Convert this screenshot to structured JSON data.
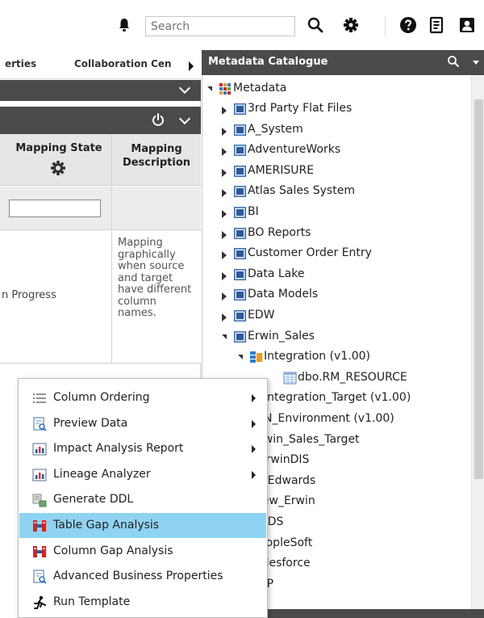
{
  "toolbar": {
    "search_placeholder": "Search"
  },
  "left_panel": {
    "tabs": [
      {
        "label": "erties"
      },
      {
        "label": "Collaboration Cen"
      }
    ],
    "grid": {
      "columns": [
        {
          "label": "Mapping State"
        },
        {
          "label": "Mapping Description"
        }
      ],
      "rows": [
        {
          "state": "n Progress",
          "description": "Mapping graphically when source and target have different column names."
        }
      ]
    }
  },
  "context_menu": {
    "items": [
      {
        "label": "Column Ordering",
        "icon": "list-icon",
        "submenu": true
      },
      {
        "label": "Preview Data",
        "icon": "preview-icon",
        "submenu": true
      },
      {
        "label": "Impact Analysis Report",
        "icon": "report-icon",
        "submenu": true
      },
      {
        "label": "Lineage Analyzer",
        "icon": "lineage-icon",
        "submenu": true
      },
      {
        "label": "Generate DDL",
        "icon": "ddl-icon",
        "submenu": false
      },
      {
        "label": "Table Gap Analysis",
        "icon": "gap-icon",
        "submenu": false,
        "selected": true
      },
      {
        "label": "Column Gap Analysis",
        "icon": "gap-icon",
        "submenu": false
      },
      {
        "label": "Advanced Business Properties",
        "icon": "properties-icon",
        "submenu": false
      },
      {
        "label": "Run Template",
        "icon": "run-icon",
        "submenu": false
      }
    ]
  },
  "catalogue": {
    "title": "Metadata Catalogue",
    "root": "Metadata",
    "nodes": [
      {
        "label": "3rd Party Flat Files"
      },
      {
        "label": "A_System"
      },
      {
        "label": "AdventureWorks"
      },
      {
        "label": "AMERISURE"
      },
      {
        "label": "Atlas Sales System"
      },
      {
        "label": "BI"
      },
      {
        "label": "BO Reports"
      },
      {
        "label": "Customer Order Entry"
      },
      {
        "label": "Data Lake"
      },
      {
        "label": "Data Models"
      },
      {
        "label": "EDW"
      },
      {
        "label": "Erwin_Sales"
      },
      {
        "label": "Integration (v1.00)"
      },
      {
        "label": "dbo.RM_RESOURCE"
      },
      {
        "label": "Integration_Target (v1.00)"
      },
      {
        "label": "N_Environment (v1.00)"
      },
      {
        "label": "rwin_Sales_Target"
      },
      {
        "label": "erwinDIS"
      },
      {
        "label": "DEdwards"
      },
      {
        "label": "lew_Erwin"
      },
      {
        "label": "DDS"
      },
      {
        "label": "eopleSoft"
      },
      {
        "label": "alesforce"
      },
      {
        "label": "AP"
      }
    ]
  }
}
